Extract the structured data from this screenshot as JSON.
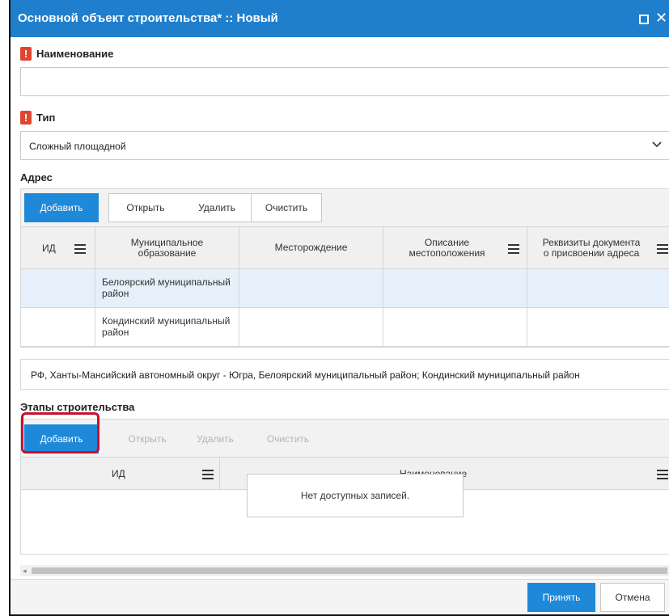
{
  "window": {
    "title": "Основной объект строительства* :: Новый",
    "title_bg": "#1f7fcc"
  },
  "fields": {
    "name_label": "Наименование",
    "name_value": "",
    "type_label": "Тип",
    "type_value": "Сложный площадной",
    "required_mark": "!"
  },
  "address": {
    "section_label": "Адрес",
    "toolbar": {
      "add": "Добавить",
      "open": "Открыть",
      "delete": "Удалить",
      "clear": "Очистить"
    },
    "columns": [
      "ИД",
      "Муниципальное образование",
      "Месторождение",
      "Описание местоположения",
      "Реквизиты документа о присвоении адреса"
    ],
    "rows": [
      {
        "id": "",
        "municipality": "Белоярский муниципальный район",
        "deposit": "",
        "location": "",
        "doc": ""
      },
      {
        "id": "",
        "municipality": "Кондинский муниципальный район",
        "deposit": "",
        "location": "",
        "doc": ""
      }
    ],
    "summary": "РФ, Ханты-Мансийский автономный округ - Югра, Белоярский муниципальный район; Кондинский муниципальный район"
  },
  "stages": {
    "section_label": "Этапы строительства",
    "toolbar": {
      "add": "Добавить",
      "open": "Открыть",
      "delete": "Удалить",
      "clear": "Очистить"
    },
    "columns": [
      "ИД",
      "Наименование"
    ],
    "empty_text": "Нет доступных записей."
  },
  "footer": {
    "accept": "Принять",
    "cancel": "Отмена"
  },
  "colors": {
    "primary": "#1e88d9",
    "required": "#e1452f",
    "highlight": "#c8102e",
    "selected_row": "#e6f0fa"
  }
}
